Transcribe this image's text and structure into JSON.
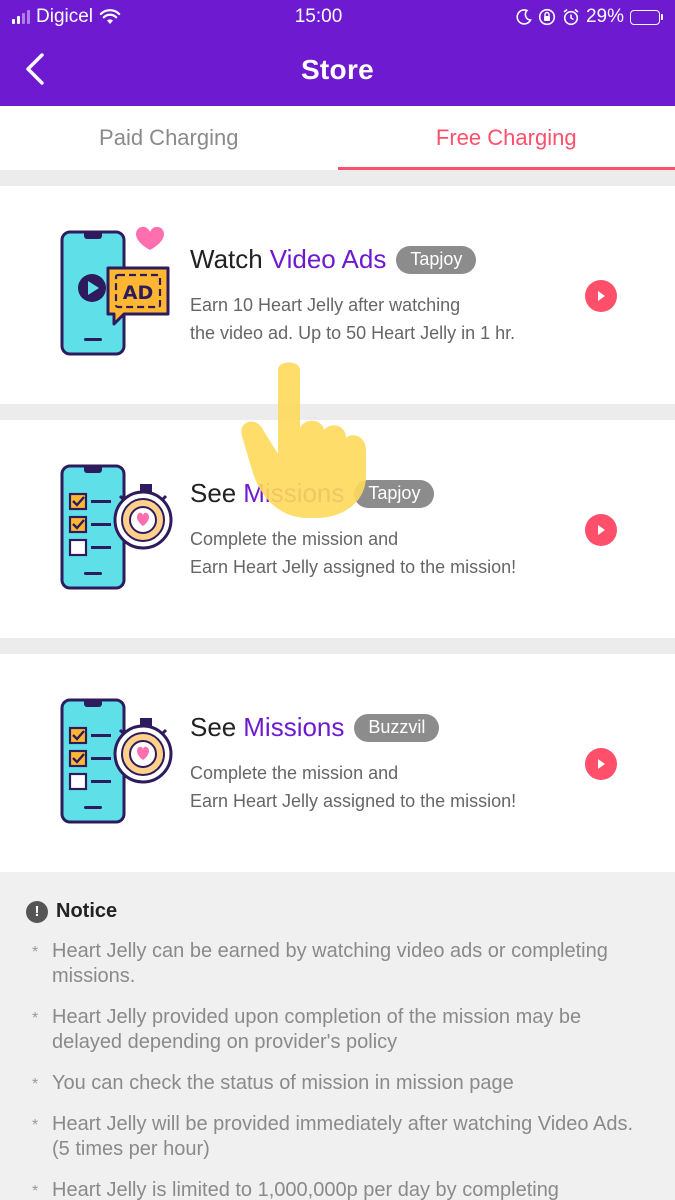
{
  "status_bar": {
    "carrier": "Digicel",
    "time": "15:00",
    "battery_percent": "29%",
    "battery_level": 0.29
  },
  "header": {
    "back_icon": "chevron-left-icon",
    "title": "Store"
  },
  "tabs": [
    {
      "label": "Paid Charging",
      "active": false
    },
    {
      "label": "Free Charging",
      "active": true
    }
  ],
  "offers": [
    {
      "title_prefix": "Watch",
      "title_accent": "Video Ads",
      "provider": "Tapjoy",
      "description_line1": "Earn 10 Heart Jelly after watching",
      "description_line2": "the video ad. Up to 50 Heart Jelly in 1 hr.",
      "illustration": "phone-video-ad-icon",
      "ad_label": "AD"
    },
    {
      "title_prefix": "See",
      "title_accent": "Missions",
      "provider": "Tapjoy",
      "description_line1": "Complete the mission and",
      "description_line2": "Earn Heart Jelly assigned to the mission!",
      "illustration": "phone-checklist-stopwatch-icon"
    },
    {
      "title_prefix": "See",
      "title_accent": "Missions",
      "provider": "Buzzvil",
      "description_line1": "Complete the mission and",
      "description_line2": "Earn Heart Jelly assigned to the mission!",
      "illustration": "phone-checklist-stopwatch-icon"
    }
  ],
  "notice": {
    "title": "Notice",
    "items": [
      "Heart Jelly can be earned by watching video ads or completing missions.",
      "Heart Jelly provided upon completion of the mission may be delayed depending on provider's policy",
      "You can check the status of mission in mission page",
      "Heart Jelly will be provided immediately after watching Video Ads. (5 times per hour)",
      "Heart Jelly is limited to 1,000,000p per day by completing"
    ]
  },
  "colors": {
    "brand_purple": "#6e1ad1",
    "accent_pink": "#ff4f6b",
    "badge_gray": "#8c8c8c",
    "hand_yellow": "#ffd95a"
  }
}
